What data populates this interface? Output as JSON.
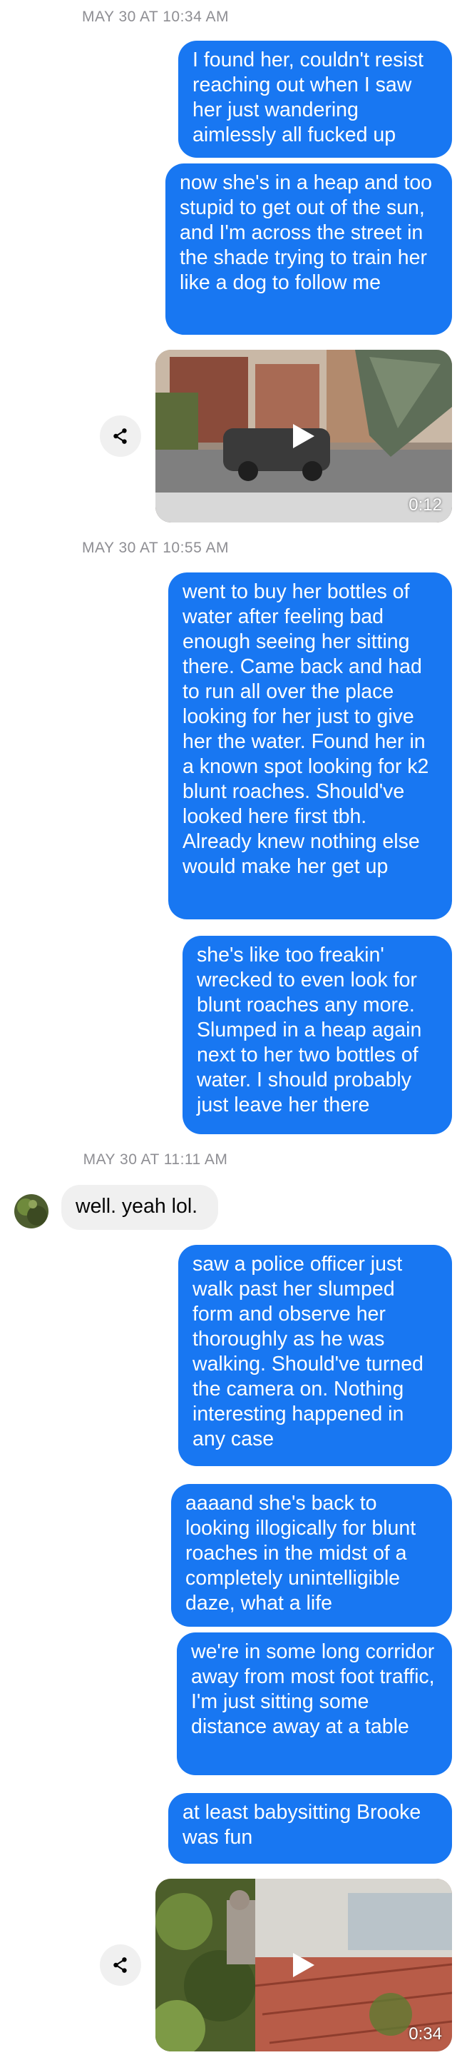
{
  "colors": {
    "outgoing_bubble": "#1877f2",
    "incoming_bubble": "#f0f0f0",
    "timestamp": "#8e8e93",
    "background": "#ffffff"
  },
  "timestamps": [
    "MAY 30 AT 10:34 AM",
    "MAY 30 AT 10:55 AM",
    "MAY 30 AT 11:11 AM"
  ],
  "messages": [
    {
      "from": "me",
      "text": "I found her, couldn't resist reaching out when I saw her just wandering aimlessly all fucked up"
    },
    {
      "from": "me",
      "text": "now she's in a heap and too stupid to get out of the sun, and I'm across the street in the shade trying to train her like a dog to follow me"
    },
    {
      "from": "me",
      "type": "video",
      "duration": "0:12",
      "icon": "play-icon"
    },
    {
      "from": "me",
      "text": "went to buy her bottles of water after feeling bad enough seeing her sitting there. Came back and had to run all over the place looking for her just to give her the water. Found her in a known spot looking for k2 blunt roaches. Should've looked here first tbh. Already knew nothing else would make her get up"
    },
    {
      "from": "me",
      "text": "she's like too freakin' wrecked to even look for blunt roaches any more. Slumped in a heap again next to her two bottles of water. I should probably just leave her there"
    },
    {
      "from": "them",
      "text": "well. yeah lol."
    },
    {
      "from": "me",
      "text": "saw a police officer just walk past her slumped form and observe her thoroughly as he was walking. Should've turned the camera on. Nothing interesting happened in any case"
    },
    {
      "from": "me",
      "text": "aaaand she's back to looking illogically for blunt roaches in the midst of a completely unintelligible daze, what a life"
    },
    {
      "from": "me",
      "text": "we're in some long corridor away from most foot traffic, I'm just sitting some distance away at a table"
    },
    {
      "from": "me",
      "text": "at least babysitting Brooke was fun"
    },
    {
      "from": "me",
      "type": "video",
      "duration": "0:34",
      "icon": "play-icon"
    }
  ]
}
